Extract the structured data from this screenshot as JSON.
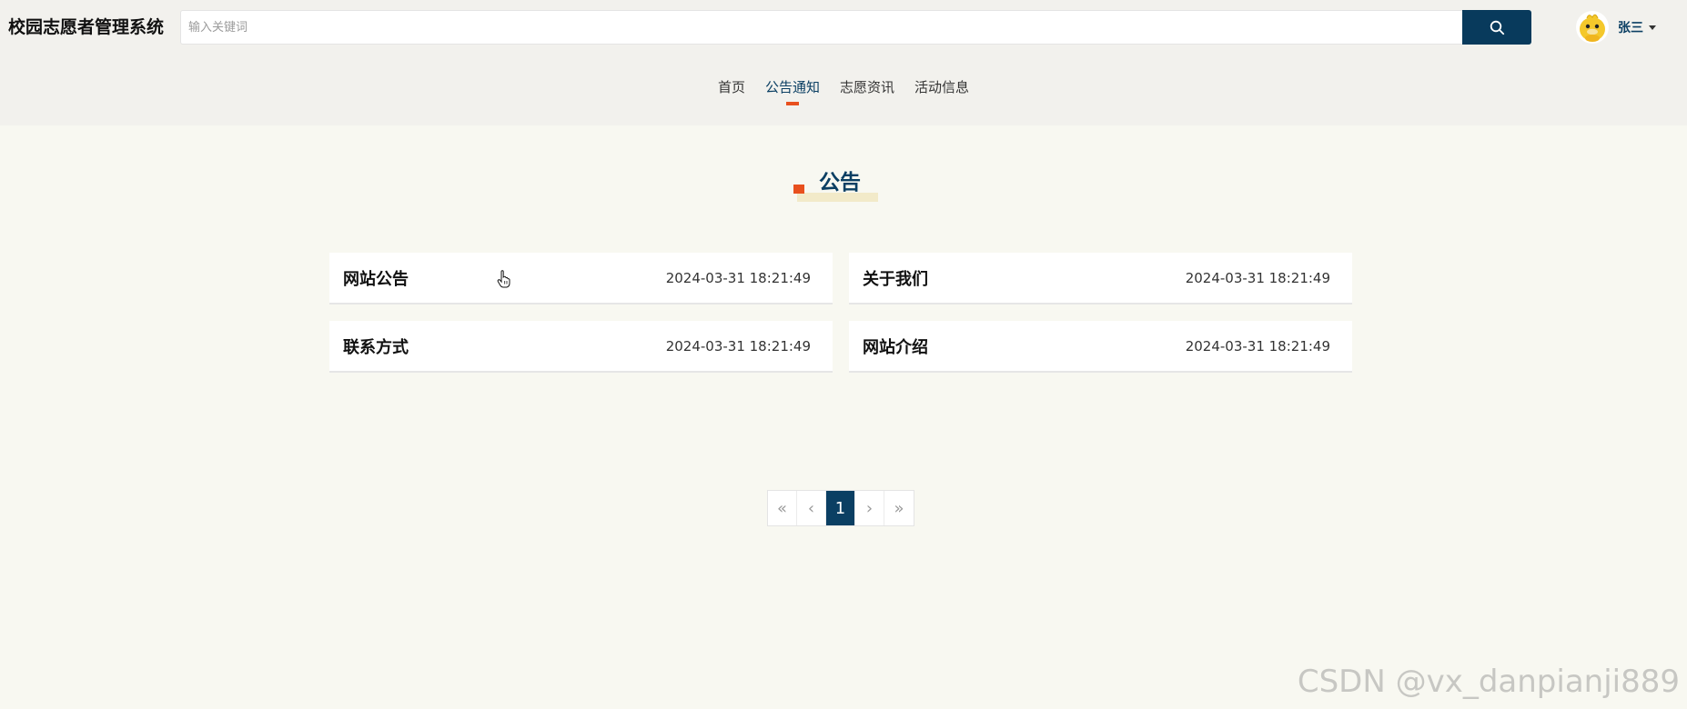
{
  "header": {
    "brand": "校园志愿者管理系统",
    "search": {
      "placeholder": "输入关键词",
      "value": "",
      "button_icon": "search-icon"
    },
    "user": {
      "name": "张三",
      "avatar_icon": "duck-avatar-icon"
    }
  },
  "nav": {
    "items": [
      {
        "label": "首页",
        "active": false
      },
      {
        "label": "公告通知",
        "active": true
      },
      {
        "label": "志愿资讯",
        "active": false
      },
      {
        "label": "活动信息",
        "active": false
      }
    ]
  },
  "section": {
    "title": "公告"
  },
  "cards": [
    {
      "title": "网站公告",
      "date": "2024-03-31 18:21:49"
    },
    {
      "title": "关于我们",
      "date": "2024-03-31 18:21:49"
    },
    {
      "title": "联系方式",
      "date": "2024-03-31 18:21:49"
    },
    {
      "title": "网站介绍",
      "date": "2024-03-31 18:21:49"
    }
  ],
  "pagination": {
    "first": "«",
    "prev": "‹",
    "current": "1",
    "next": "›",
    "last": "»"
  },
  "watermark": "CSDN @vx_danpianji889",
  "colors": {
    "primary": "#0b3f63",
    "accent": "#e8501e",
    "background": "#f8f8f1",
    "header_background": "#f2f1ed"
  }
}
